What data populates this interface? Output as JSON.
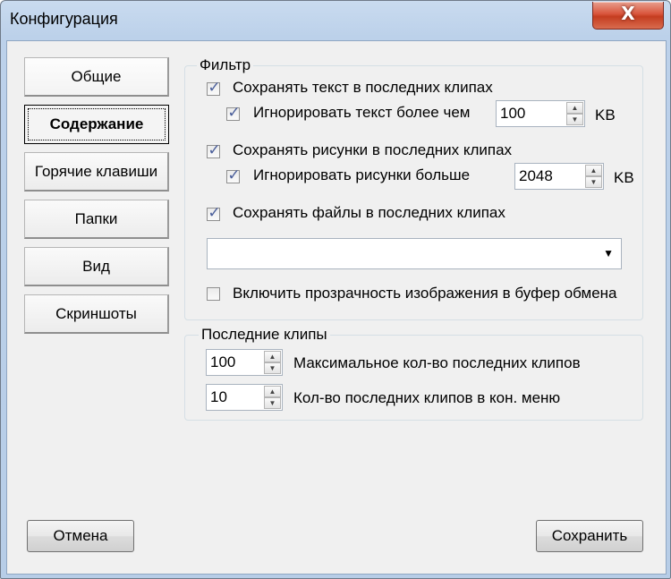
{
  "window": {
    "title": "Конфигурация",
    "close_glyph": "X"
  },
  "tabs": [
    {
      "label": "Общие"
    },
    {
      "label": "Содержание"
    },
    {
      "label": "Горячие клавиши"
    },
    {
      "label": "Папки"
    },
    {
      "label": "Вид"
    },
    {
      "label": "Скриншоты"
    }
  ],
  "filter": {
    "label": "Фильтр",
    "save_text": {
      "label": "Сохранять текст в последних клипах",
      "checked": true
    },
    "ignore_text": {
      "label": "Игнорировать текст более чем",
      "checked": true,
      "value": "100",
      "unit": "KB"
    },
    "save_images": {
      "label": "Сохранять рисунки в последних клипах",
      "checked": true
    },
    "ignore_images": {
      "label": "Игнорировать рисунки больше",
      "checked": true,
      "value": "2048",
      "unit": "KB"
    },
    "save_files": {
      "label": "Сохранять файлы в последних клипах",
      "checked": true
    },
    "combo_value": "",
    "transparency": {
      "label": "Включить прозрачность изображения в буфер обмена",
      "checked": false
    }
  },
  "recent": {
    "label": "Последние клипы",
    "max": {
      "value": "100",
      "label": "Максимальное кол-во последних клипов"
    },
    "menu": {
      "value": "10",
      "label": "Кол-во последних клипов в кон. меню"
    }
  },
  "buttons": {
    "cancel": "Отмена",
    "save": "Сохранить"
  },
  "icons": {
    "checkbox_tick": "✓",
    "spin_up": "▲",
    "spin_down": "▼",
    "combo_arrow": "▼"
  }
}
